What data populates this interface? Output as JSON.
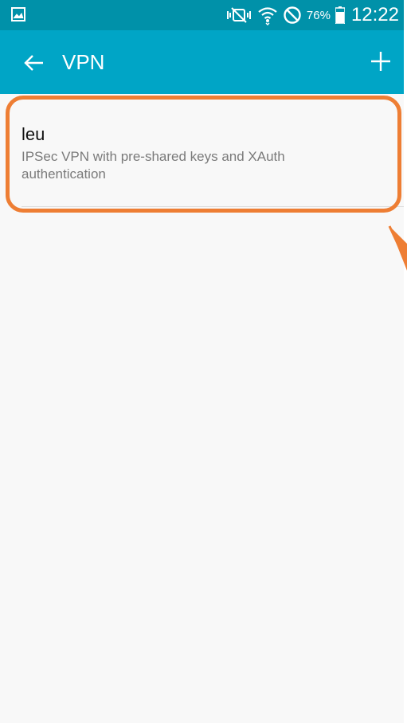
{
  "status_bar": {
    "left_icon": "image-notification-icon",
    "icons": [
      "mute-vibrate-icon",
      "wifi-icon",
      "do-not-disturb-icon",
      "battery-icon"
    ],
    "battery_percent": "76%",
    "time": "12:22"
  },
  "app_bar": {
    "back_icon": "arrow-left-icon",
    "title": "VPN",
    "add_icon": "plus-icon"
  },
  "vpn_list": [
    {
      "name": "leu",
      "description": "IPSec VPN with pre-shared keys and XAuth authentication"
    }
  ],
  "colors": {
    "status_bar": "#0091a9",
    "app_bar": "#00a5c6",
    "highlight": "#ee7e34",
    "background": "#f8f8f8"
  }
}
